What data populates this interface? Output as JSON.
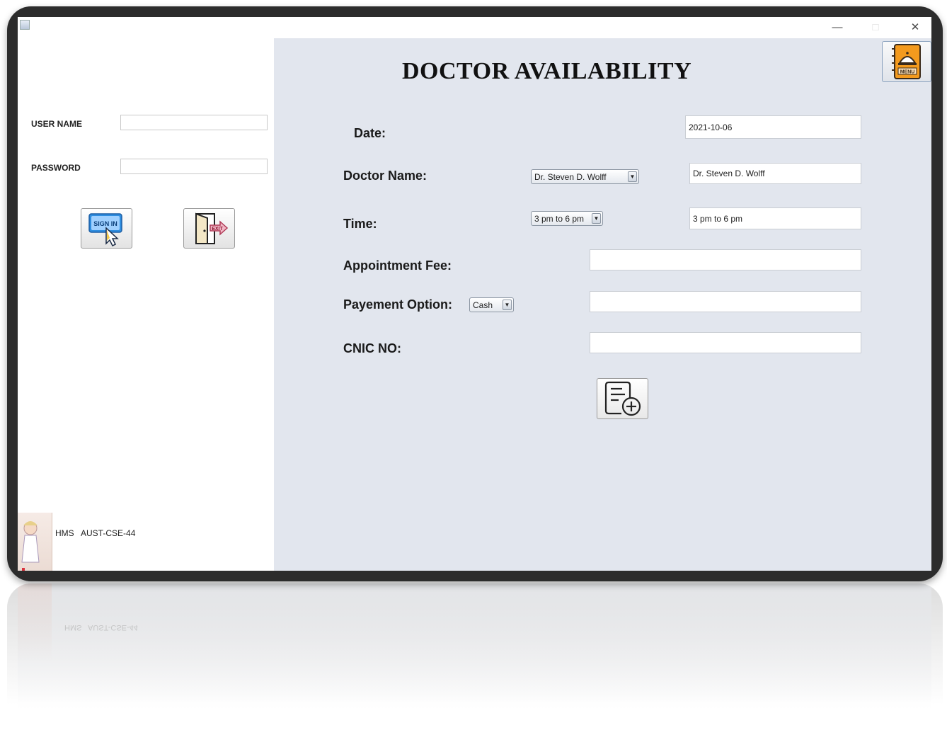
{
  "window": {
    "controls": {
      "minimize": "—",
      "maximize": "□",
      "close": "✕"
    }
  },
  "login": {
    "username_label": "USER NAME",
    "username_value": "",
    "password_label": "PASSWORD",
    "password_value": "",
    "signin_text": "SIGN IN",
    "signin_icon": "sign-in-cursor-icon",
    "exit_text": "EXIT",
    "exit_icon": "exit-door-icon"
  },
  "footer": {
    "label": "HMS   AUST-CSE-44"
  },
  "page": {
    "title": "DOCTOR AVAILABILITY"
  },
  "menu_button": {
    "text": "MENU",
    "icon": "menu-bell-book-icon"
  },
  "form": {
    "date": {
      "label": "Date:",
      "value": "2021-10-06"
    },
    "doctor": {
      "label": "Doctor Name:",
      "selected": "Dr. Steven D. Wolff",
      "value": "Dr. Steven D. Wolff"
    },
    "time": {
      "label": "Time:",
      "selected": "3 pm to 6 pm",
      "value": "3 pm to 6 pm"
    },
    "fee": {
      "label": "Appointment Fee:",
      "value": ""
    },
    "payment": {
      "label": "Payement Option:",
      "selected": "Cash",
      "value": ""
    },
    "cnic": {
      "label": "CNIC NO:",
      "value": ""
    },
    "add_icon": "add-document-icon"
  },
  "colors": {
    "frame": "#2c2c2c",
    "right_panel": "#e2e6ee",
    "menu_orange": "#f39a1e"
  }
}
